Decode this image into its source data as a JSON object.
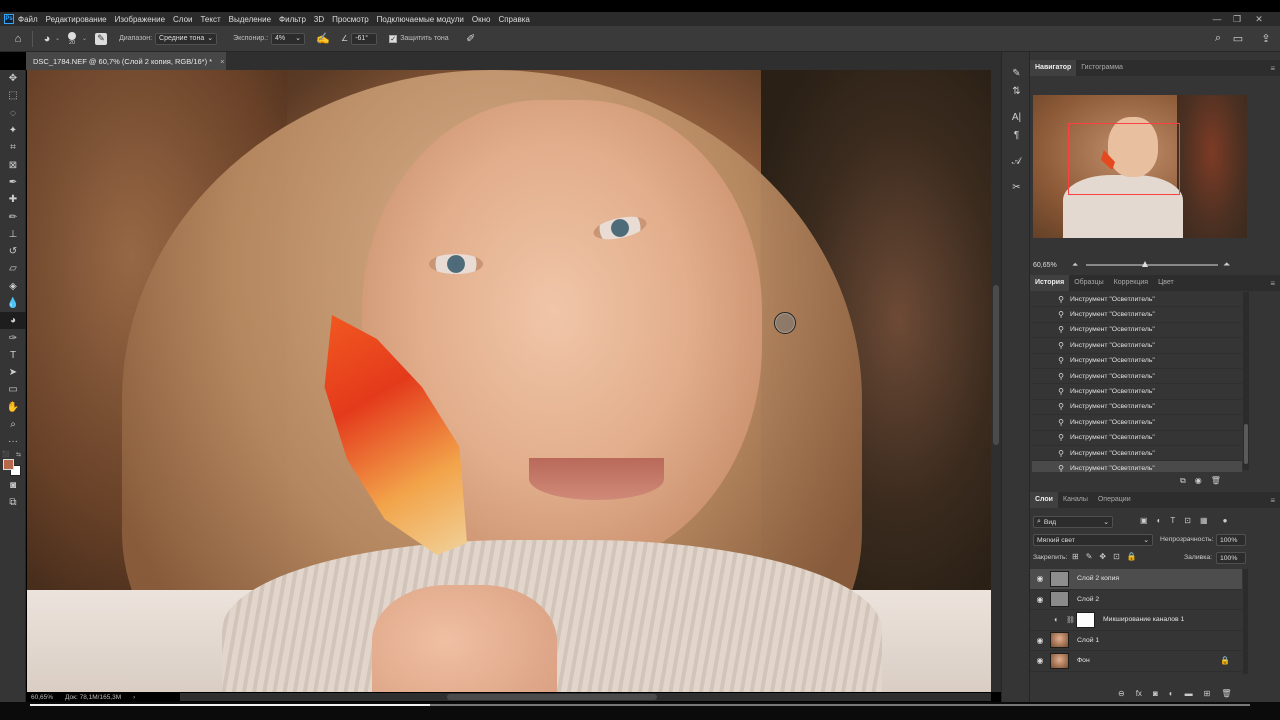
{
  "menubar": {
    "app_logo": "Ps",
    "items": [
      "Файл",
      "Редактирование",
      "Изображение",
      "Слои",
      "Текст",
      "Выделение",
      "Фильтр",
      "3D",
      "Просмотр",
      "Подключаемые модули",
      "Окно",
      "Справка"
    ],
    "window_controls": [
      "minimize-icon",
      "restore-icon",
      "close-icon"
    ]
  },
  "options_bar": {
    "brush_size": "20",
    "range_label": "Диапазон:",
    "range_value": "Средние тона",
    "exposure_label": "Экспонир.:",
    "exposure_value": "4%",
    "angle_value": "-61°",
    "protect_tones_label": "Защитить тона",
    "protect_tones_checked": true
  },
  "document": {
    "tab_title": "DSC_1784.NEF @ 60,7% (Слой 2 копия, RGB/16*) *",
    "zoom": "60,65%",
    "doc_info": "Док: 78,1M/165,3M"
  },
  "navigator": {
    "tabs": [
      "Навигатор",
      "Гистограмма"
    ],
    "active_tab": "Навигатор",
    "zoom_value": "60,65%",
    "zoom_slider_fraction": 0.45
  },
  "history": {
    "tabs": [
      "История",
      "Образцы",
      "Коррекция",
      "Цвет"
    ],
    "active_tab": "История",
    "items": [
      "Инструмент \"Осветлитель\"",
      "Инструмент \"Осветлитель\"",
      "Инструмент \"Осветлитель\"",
      "Инструмент \"Осветлитель\"",
      "Инструмент \"Осветлитель\"",
      "Инструмент \"Осветлитель\"",
      "Инструмент \"Осветлитель\"",
      "Инструмент \"Осветлитель\"",
      "Инструмент \"Осветлитель\"",
      "Инструмент \"Осветлитель\"",
      "Инструмент \"Осветлитель\"",
      "Инструмент \"Осветлитель\""
    ]
  },
  "layers": {
    "tabs": [
      "Слои",
      "Каналы",
      "Операции"
    ],
    "active_tab": "Слои",
    "filter_label": "Вид",
    "blend_mode": "Мягкий свет",
    "opacity_label": "Непрозрачность:",
    "opacity_value": "100%",
    "lock_label": "Закрепить:",
    "fill_label": "Заливка:",
    "fill_value": "100%",
    "list": [
      {
        "name": "Слой 2 копия",
        "visible": true,
        "selected": true
      },
      {
        "name": "Слой 2",
        "visible": true,
        "selected": false
      },
      {
        "name": "Микширование каналов 1",
        "visible": false,
        "selected": false
      },
      {
        "name": "Слой 1",
        "visible": true,
        "selected": false
      },
      {
        "name": "Фон",
        "visible": true,
        "selected": false,
        "locked": true
      }
    ]
  },
  "colors": {
    "foreground": "#b8684a",
    "background": "#ffffff",
    "accent_blue": "#31a8ff",
    "nav_frame": "#ff4040"
  }
}
